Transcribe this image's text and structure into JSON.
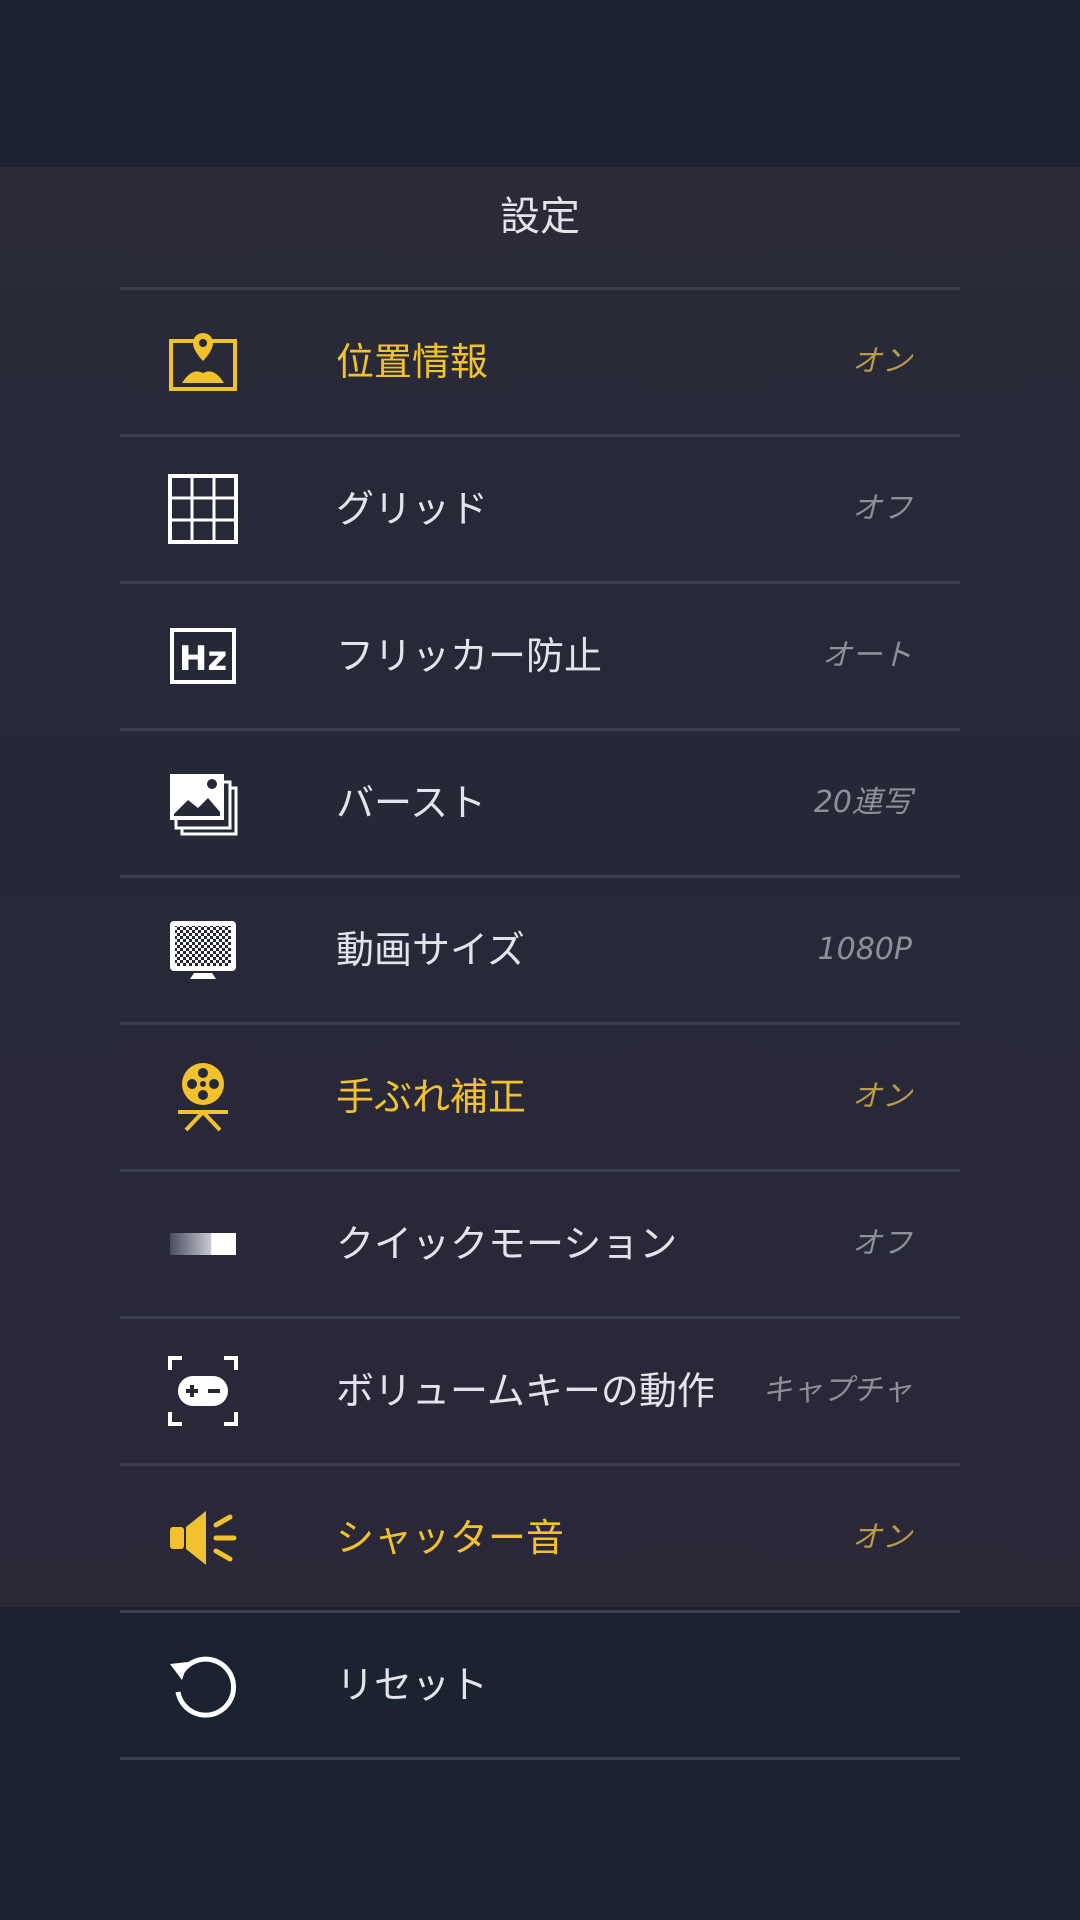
{
  "title": "設定",
  "colors": {
    "accent": "#f2c12e",
    "background": "#1b2230",
    "panel": "#282a38",
    "text": "#e3e4ea",
    "value_text": "#8d8f99",
    "divider": "#3b3f4d"
  },
  "settings": [
    {
      "icon": "location-pin-icon",
      "label": "位置情報",
      "value": "オン",
      "active": true
    },
    {
      "icon": "grid-icon",
      "label": "グリッド",
      "value": "オフ",
      "active": false
    },
    {
      "icon": "hz-icon",
      "label": "フリッカー防止",
      "value": "オート",
      "active": false
    },
    {
      "icon": "burst-photos-icon",
      "label": "バースト",
      "value": "20連写",
      "active": false
    },
    {
      "icon": "video-size-monitor-icon",
      "label": "動画サイズ",
      "value": "1080P",
      "active": false
    },
    {
      "icon": "film-reel-stabilization-icon",
      "label": "手ぶれ補正",
      "value": "オン",
      "active": true
    },
    {
      "icon": "quick-motion-gradient-icon",
      "label": "クイックモーション",
      "value": "オフ",
      "active": false
    },
    {
      "icon": "volume-key-icon",
      "label": "ボリュームキーの動作",
      "value": "キャプチャ",
      "active": false
    },
    {
      "icon": "speaker-icon",
      "label": "シャッター音",
      "value": "オン",
      "active": true
    },
    {
      "icon": "reset-arrow-icon",
      "label": "リセット",
      "value": "",
      "active": false
    }
  ]
}
